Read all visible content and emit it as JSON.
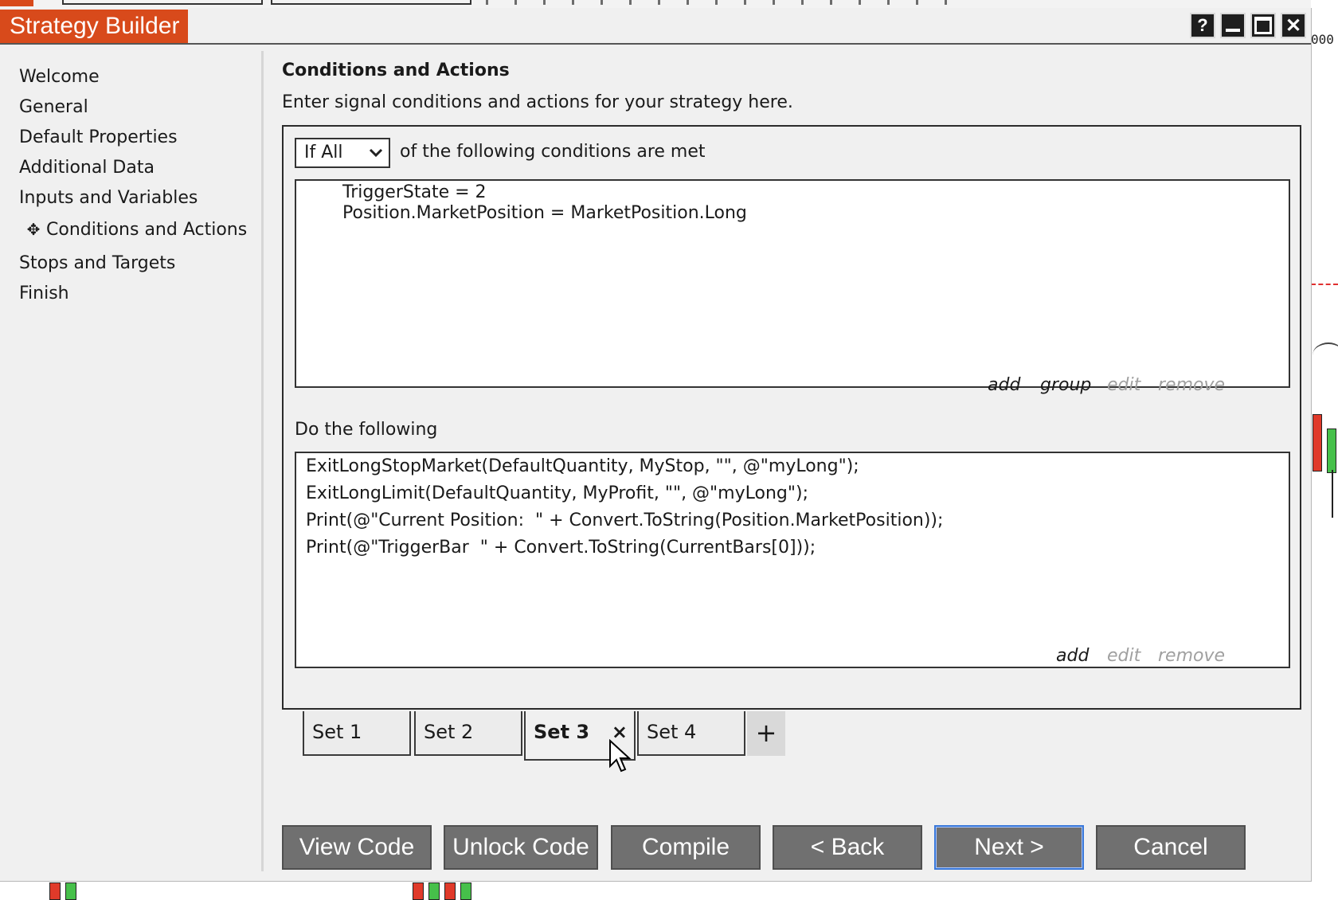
{
  "window": {
    "title": "Strategy Builder",
    "controls": {
      "help": "?",
      "minimize": "",
      "maximize": "",
      "close": "✕"
    }
  },
  "background": {
    "axis_label": "000"
  },
  "nav": {
    "items": [
      {
        "label": "Welcome"
      },
      {
        "label": "General"
      },
      {
        "label": "Default Properties"
      },
      {
        "label": "Additional Data"
      },
      {
        "label": "Inputs and Variables"
      },
      {
        "label": "Conditions and Actions",
        "active": true,
        "bullet": "✥"
      },
      {
        "label": "Stops and Targets"
      },
      {
        "label": "Finish"
      }
    ]
  },
  "main": {
    "heading": "Conditions and Actions",
    "description": "Enter signal conditions and actions for your strategy here.",
    "condition_mode": {
      "selected": "If All",
      "suffix": "of the following conditions are met"
    },
    "conditions": [
      "TriggerState = 2",
      "Position.MarketPosition = MarketPosition.Long"
    ],
    "condition_links": {
      "add": "add",
      "group": "group",
      "edit": "edit",
      "remove": "remove"
    },
    "actions_label": "Do the following",
    "actions": [
      "ExitLongStopMarket(DefaultQuantity, MyStop, \"\", @\"myLong\");",
      "ExitLongLimit(DefaultQuantity, MyProfit, \"\", @\"myLong\");",
      "Print(@\"Current Position:  \" + Convert.ToString(Position.MarketPosition));",
      "Print(@\"TriggerBar  \" + Convert.ToString(CurrentBars[0]));"
    ],
    "action_links": {
      "add": "add",
      "edit": "edit",
      "remove": "remove"
    },
    "tabs": [
      {
        "label": "Set 1"
      },
      {
        "label": "Set 2"
      },
      {
        "label": "Set 3",
        "active": true,
        "close": "×"
      },
      {
        "label": "Set 4"
      }
    ],
    "add_tab": "+"
  },
  "footer": {
    "view_code": "View Code",
    "unlock_code": "Unlock Code",
    "compile": "Compile",
    "back": "< Back",
    "next": "Next >",
    "cancel": "Cancel"
  },
  "colors": {
    "title_bg": "#d84a1b",
    "button_bg": "#707070",
    "focus_border": "#3a78d8",
    "disabled_link": "#a0a0a0"
  }
}
